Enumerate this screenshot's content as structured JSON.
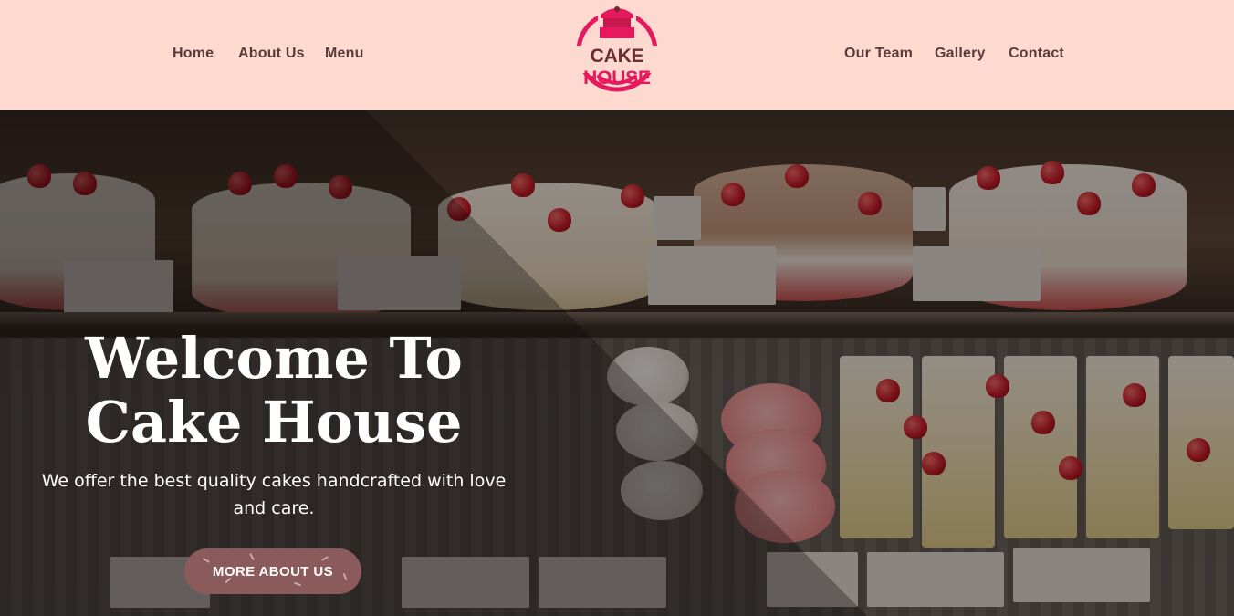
{
  "brand": {
    "name_part1": "CAKE",
    "name_part2": "HOUSE",
    "logo_icon": "cake-icon"
  },
  "nav": {
    "left": [
      {
        "label": "Home"
      },
      {
        "label": "About Us"
      },
      {
        "label": "Menu"
      }
    ],
    "right": [
      {
        "label": "Our Team"
      },
      {
        "label": "Gallery"
      },
      {
        "label": "Contact"
      }
    ]
  },
  "hero": {
    "title_line1": "Welcome To",
    "title_line2": "Cake House",
    "subtitle": "We offer the best quality cakes handcrafted with love and care.",
    "cta_label": "MORE ABOUT US"
  },
  "colors": {
    "header_bg": "#fdd9cf",
    "nav_text": "#5b3a3a",
    "logo_pink": "#e6195e",
    "logo_brown": "#6b2e2e",
    "cta_bg": "#8b5a5a"
  }
}
